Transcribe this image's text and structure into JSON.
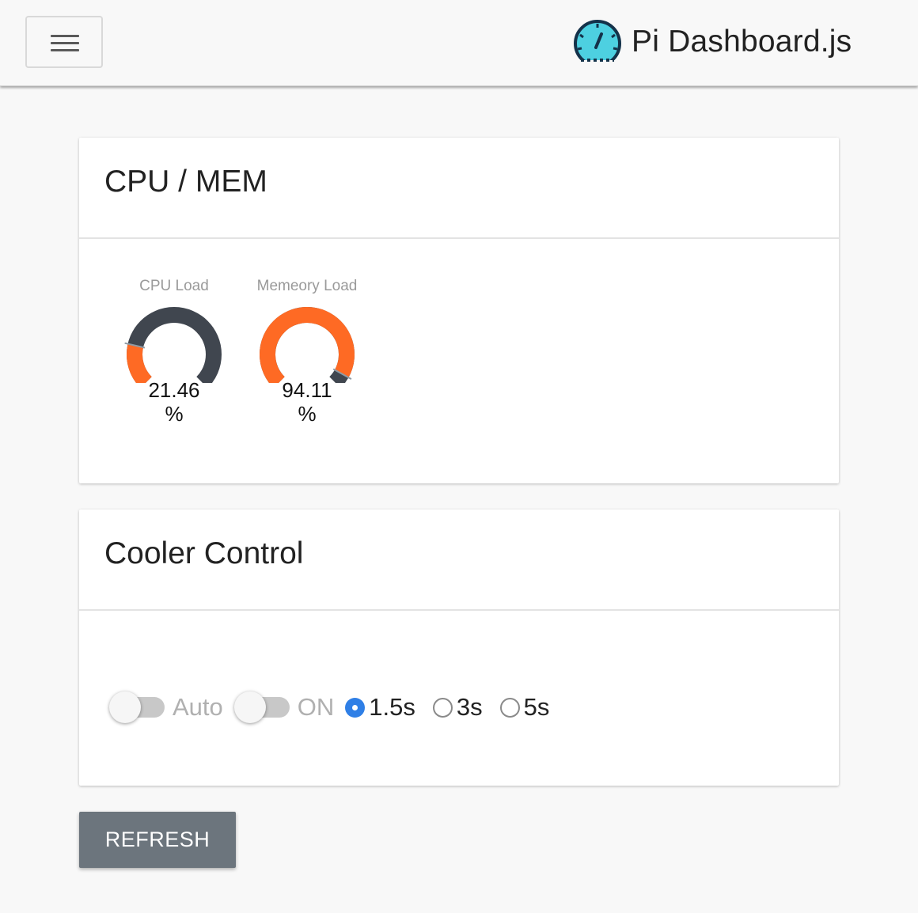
{
  "header": {
    "brand_title": "Pi Dashboard.js",
    "menu_icon": "hamburger-menu-icon",
    "logo_icon": "speedometer-icon"
  },
  "cpu_mem_card": {
    "title": "CPU / MEM",
    "gauges": [
      {
        "label": "CPU Load",
        "value": "21.46",
        "unit": "%",
        "percent": 21.46
      },
      {
        "label": "Memeory Load",
        "value": "94.11",
        "unit": "%",
        "percent": 94.11
      }
    ]
  },
  "cooler_card": {
    "title": "Cooler Control",
    "switches": [
      {
        "label": "Auto",
        "checked": false
      },
      {
        "label": "ON",
        "checked": false
      }
    ],
    "intervals": [
      {
        "label": "1.5s",
        "checked": true
      },
      {
        "label": "3s",
        "checked": false
      },
      {
        "label": "5s",
        "checked": false
      }
    ]
  },
  "refresh_button": {
    "label": "REFRESH"
  },
  "colors": {
    "gauge_fill": "#fe6a24",
    "gauge_track": "#40464f",
    "radio_checked": "#2f7fe6",
    "button_bg": "#6c757d",
    "logo_fill": "#4dd0e1"
  }
}
